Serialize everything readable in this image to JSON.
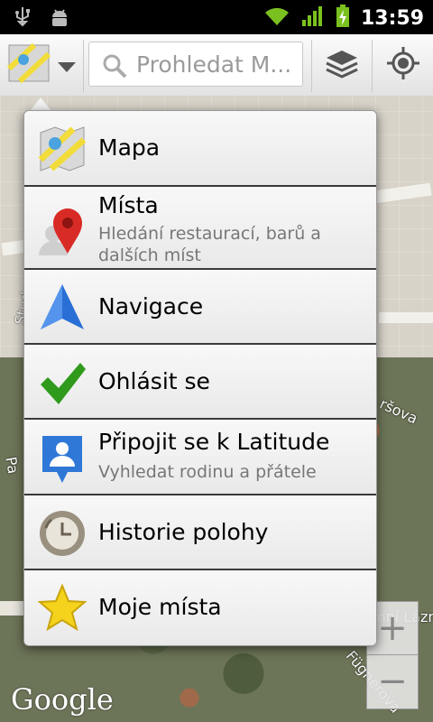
{
  "status": {
    "time": "13:59"
  },
  "toolbar": {
    "search_placeholder": "Prohledat M..."
  },
  "map": {
    "streets": [
      "Studentská",
      "Pa",
      "ršova",
      "mní Lázně",
      "Fügnerova"
    ],
    "zoom_in": "+",
    "zoom_out": "−",
    "logo": "Google"
  },
  "menu": {
    "items": [
      {
        "title": "Mapa",
        "subtitle": ""
      },
      {
        "title": "Místa",
        "subtitle": "Hledání restaurací, barů a dalších míst"
      },
      {
        "title": "Navigace",
        "subtitle": ""
      },
      {
        "title": "Ohlásit se",
        "subtitle": ""
      },
      {
        "title": "Připojit se k Latitude",
        "subtitle": "Vyhledat rodinu a přátele"
      },
      {
        "title": "Historie polohy",
        "subtitle": ""
      },
      {
        "title": "Moje místa",
        "subtitle": ""
      }
    ]
  }
}
